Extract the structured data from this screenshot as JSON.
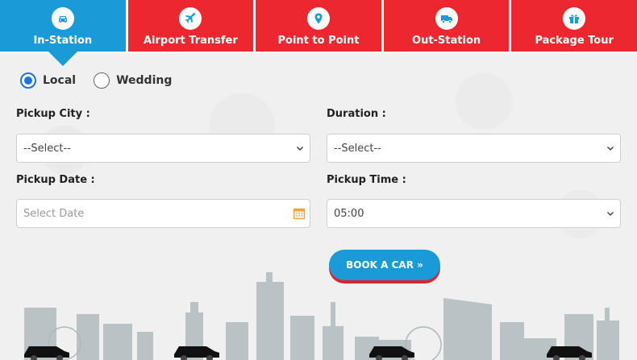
{
  "tabs": [
    {
      "label": "In-Station",
      "icon": "car-icon",
      "active": true
    },
    {
      "label": "Airport Transfer",
      "icon": "airplane-icon",
      "active": false
    },
    {
      "label": "Point to Point",
      "icon": "map-pin-icon",
      "active": false
    },
    {
      "label": "Out-Station",
      "icon": "truck-icon",
      "active": false
    },
    {
      "label": "Package Tour",
      "icon": "gift-icon",
      "active": false
    }
  ],
  "trip_type": {
    "options": [
      {
        "label": "Local",
        "checked": true
      },
      {
        "label": "Wedding",
        "checked": false
      }
    ]
  },
  "form": {
    "pickup_city": {
      "label": "Pickup City :",
      "value": "--Select--"
    },
    "duration": {
      "label": "Duration :",
      "value": "--Select--"
    },
    "pickup_date": {
      "label": "Pickup Date :",
      "placeholder": "Select Date"
    },
    "pickup_time": {
      "label": "Pickup Time :",
      "value": "05:00"
    }
  },
  "book_button": {
    "label": "BOOK A CAR »"
  },
  "colors": {
    "accent_blue": "#1a9bd7",
    "accent_red": "#ed2730",
    "radio_blue": "#1a73e8",
    "calendar_orange": "#f0a33a"
  }
}
